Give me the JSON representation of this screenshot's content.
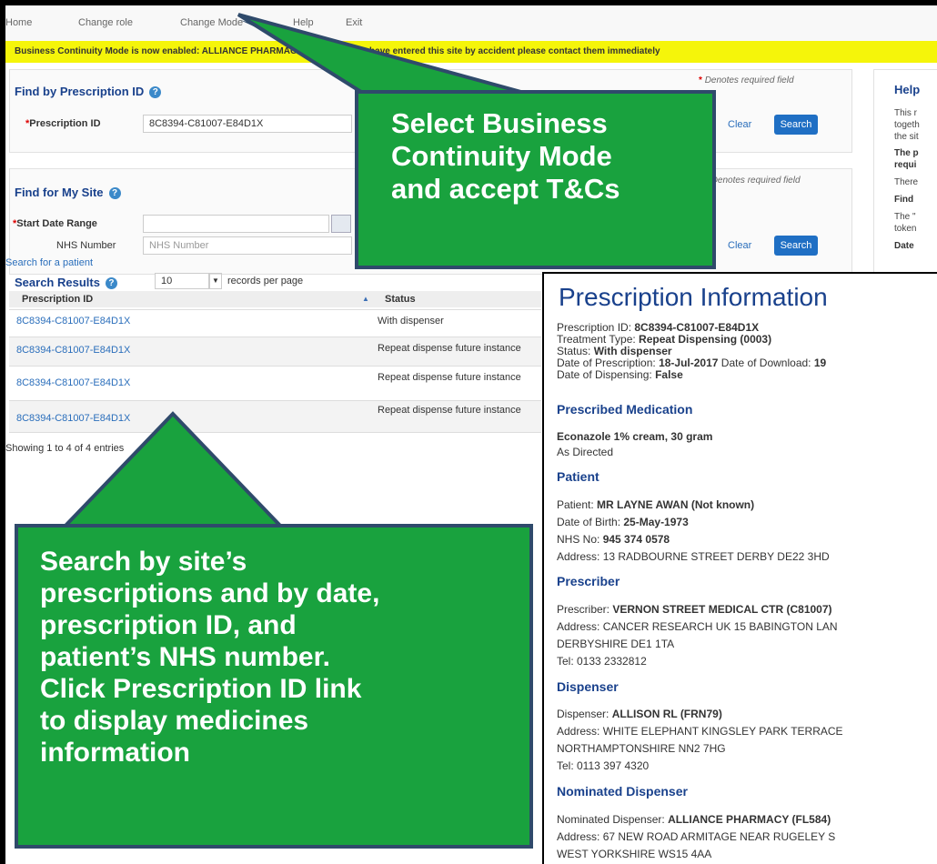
{
  "nav": {
    "home": "Home",
    "change_role": "Change role",
    "change_mode": "Change Mode",
    "help": "Help",
    "exit": "Exit"
  },
  "banner": "Business Continuity Mode is now enabled: ALLIANCE PHARMACY (FL584). If you have entered this site by accident please contact them immediately",
  "find_by_id": {
    "title": "Find by Prescription ID",
    "required_note": "Denotes required field",
    "label": "Prescription ID",
    "value": "8C8394-C81007-E84D1X",
    "clear": "Clear",
    "search": "Search"
  },
  "find_site": {
    "title": "Find for My Site",
    "required_note": "Denotes required field",
    "start_date_label": "Start Date Range",
    "nhs_label": "NHS Number",
    "nhs_placeholder": "NHS Number",
    "search_patient": "Search for a patient",
    "clear": "Clear",
    "search": "Search"
  },
  "results": {
    "title": "Search Results",
    "per_page_value": "10",
    "per_page_label": "records per page",
    "col_id": "Prescription ID",
    "col_status": "Status",
    "showing": "Showing 1 to 4 of 4 entries",
    "rows": [
      {
        "id": "8C8394-C81007-E84D1X",
        "status": "With dispenser"
      },
      {
        "id": "8C8394-C81007-E84D1X",
        "status": "Repeat dispense future instance"
      },
      {
        "id": "8C8394-C81007-E84D1X",
        "status": "Repeat dispense future instance"
      },
      {
        "id": "8C8394-C81007-E84D1X",
        "status": "Repeat dispense future instance"
      }
    ]
  },
  "help_panel": {
    "title": "Help",
    "line1": "This r",
    "line2": "togeth",
    "line3": "the sit",
    "line4": "The p",
    "line5": "requi",
    "line6": "There",
    "line7": "Find",
    "line8": "The \"",
    "line9": "token",
    "line10": "Date"
  },
  "callouts": {
    "top": [
      "Select Business",
      "Continuity Mode",
      "and accept T&Cs"
    ],
    "bottom": [
      "Search by site’s",
      "prescriptions and by date,",
      "prescription ID, and",
      "patient’s NHS number.",
      "Click Prescription ID link",
      "to display medicines",
      "information"
    ]
  },
  "info": {
    "title": "Prescription Information",
    "prescription_id_label": "Prescription ID: ",
    "prescription_id": "8C8394-C81007-E84D1X",
    "treatment_label": "Treatment Type: ",
    "treatment": "Repeat Dispensing (0003)",
    "status_label": "Status: ",
    "status": "With dispenser",
    "date_label": "Date of Prescription: ",
    "date": "18-Jul-2017",
    "download_label": " Date of Download: ",
    "download": "19",
    "dispensing_label": "Date of Dispensing: ",
    "dispensing": "False",
    "med_heading": "Prescribed Medication",
    "med_name": "Econazole 1% cream, 30 gram",
    "med_dir": "As Directed",
    "patient_heading": "Patient",
    "patient_label": "Patient: ",
    "patient": "MR LAYNE AWAN (Not known)",
    "dob_label": "Date of Birth: ",
    "dob": "25-May-1973",
    "nhs_label": "NHS No: ",
    "nhs": "945 374 0578",
    "patient_addr": "Address: 13 RADBOURNE STREET DERBY DE22 3HD",
    "prescriber_heading": "Prescriber",
    "prescriber_label": "Prescriber: ",
    "prescriber": "VERNON STREET MEDICAL CTR (C81007)",
    "prescriber_addr1": "Address: CANCER RESEARCH UK 15 BABINGTON LAN",
    "prescriber_addr2": "DERBYSHIRE DE1 1TA",
    "prescriber_tel": "Tel: 0133 2332812",
    "dispenser_heading": "Dispenser",
    "dispenser_label": "Dispenser: ",
    "dispenser": "ALLISON RL (FRN79)",
    "dispenser_addr1": "Address: WHITE ELEPHANT KINGSLEY PARK TERRACE",
    "dispenser_addr2": "NORTHAMPTONSHIRE NN2 7HG",
    "dispenser_tel": "Tel: 0113 397 4320",
    "nominated_heading": "Nominated Dispenser",
    "nominated_label": "Nominated Dispenser: ",
    "nominated": "ALLIANCE PHARMACY (FL584)",
    "nominated_addr1": "Address: 67 NEW ROAD ARMITAGE NEAR RUGELEY S",
    "nominated_addr2": "WEST YORKSHIRE WS15 4AA"
  },
  "colors": {
    "accent": "#1f6fc4",
    "title": "#19418c",
    "callout": "#19a23e",
    "banner": "#f5f50a"
  }
}
